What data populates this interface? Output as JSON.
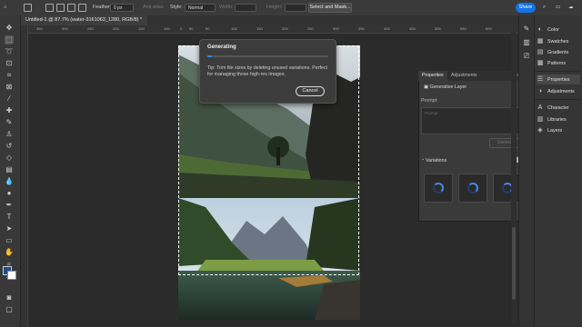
{
  "options_bar": {
    "feather_label": "Feather:",
    "feather_value": "0 px",
    "anti_alias_label": "Anti-alias",
    "style_label": "Style:",
    "style_value": "Normal",
    "width_label": "Width:",
    "height_label": "Height:",
    "select_mask_label": "Select and Mask...",
    "share_label": "Share"
  },
  "document": {
    "tab_title": "Untitled-1 @ 87.7% (water-3161063_1280, RGB/8) *"
  },
  "ruler_ticks": [
    "350",
    "300",
    "250",
    "200",
    "150",
    "100",
    "50",
    "0",
    "50",
    "100",
    "150",
    "200",
    "250",
    "300",
    "350",
    "400",
    "450",
    "500",
    "550",
    "600"
  ],
  "generating": {
    "title": "Generating",
    "tip": "Tip:  Trim file sizes by deleting unused variations. Perfect for managing those high-res images.",
    "cancel_label": "Cancel",
    "progress": 0.04
  },
  "properties": {
    "tab_properties": "Properties",
    "tab_adjustments": "Adjustments",
    "layer_type": "Generative Layer",
    "prompt_label": "Prompt:",
    "prompt_placeholder": "Prompt",
    "generate_label": "Generate",
    "variations_label": "Variations"
  },
  "dock": {
    "items": [
      "Color",
      "Swatches",
      "Gradients",
      "Patterns",
      "Properties",
      "Adjustments",
      "Character",
      "Libraries",
      "Layers"
    ]
  },
  "colors": {
    "accent": "#1473e6",
    "foreground": "#1f4a8a",
    "background": "#ffffff"
  }
}
